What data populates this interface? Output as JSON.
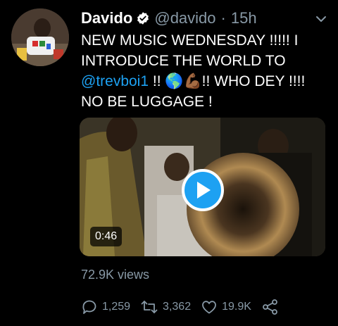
{
  "tweet": {
    "author_name": "Davido",
    "handle": "@davido",
    "separator": "·",
    "time": "15h",
    "text_line1": "NEW MUSIC WEDNESDAY !!!!! I",
    "text_line2": "INTRODUCE THE WORLD TO",
    "mention": "@trevboi1",
    "text_after_mention": " !! 🌎💪🏾!! WHO DEY !!!!",
    "text_line4": "NO BE LUGGAGE !"
  },
  "media": {
    "duration": "0:46",
    "views": "72.9K views"
  },
  "actions": {
    "reply_count": "1,259",
    "retweet_count": "3,362",
    "like_count": "19.9K"
  },
  "colors": {
    "background": "#000000",
    "accent": "#1da1f2",
    "muted": "#8899a6"
  },
  "icons": [
    "verified-badge-icon",
    "chevron-down-icon",
    "play-icon",
    "reply-icon",
    "retweet-icon",
    "like-icon",
    "share-icon"
  ]
}
